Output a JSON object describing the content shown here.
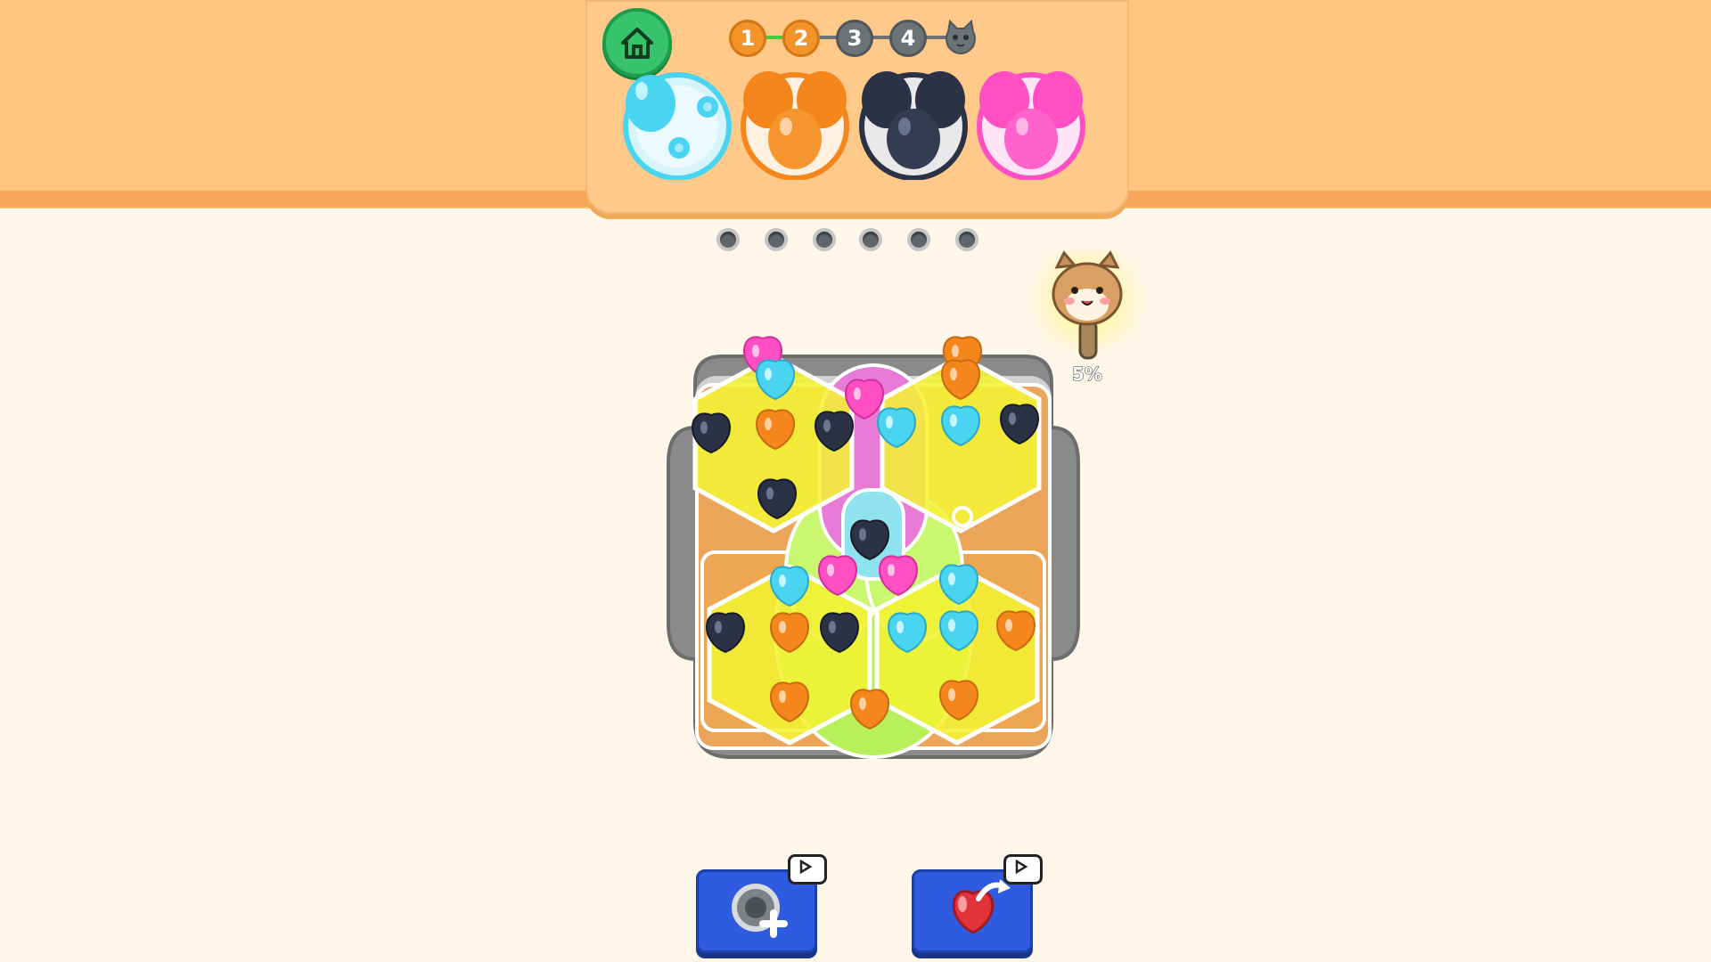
{
  "progress": {
    "steps": [
      {
        "label": "1",
        "state": "done"
      },
      {
        "label": "2",
        "state": "done"
      },
      {
        "label": "3",
        "state": "todo"
      },
      {
        "label": "4",
        "state": "todo"
      }
    ]
  },
  "targets": [
    {
      "color": "#49d5f2",
      "filled": 1,
      "capacity": 3
    },
    {
      "color": "#f4861c",
      "filled": 3,
      "capacity": 3
    },
    {
      "color": "#2b3245",
      "filled": 3,
      "capacity": 3
    },
    {
      "color": "#ff4fc3",
      "filled": 3,
      "capacity": 3
    }
  ],
  "holding_slots": 6,
  "mascot": {
    "progress_label": "5%",
    "progress": 0.05
  },
  "tools": [
    {
      "name": "add-hole",
      "icon": "add-slot-icon"
    },
    {
      "name": "move-balloon",
      "icon": "balloon-move-icon"
    }
  ],
  "colors": {
    "cyan": "#49d5f2",
    "orange": "#f4861c",
    "navy": "#2b3245",
    "pink": "#ff4fc3",
    "yellow_glass": "#f3f233",
    "lime": "#b7f05a"
  }
}
